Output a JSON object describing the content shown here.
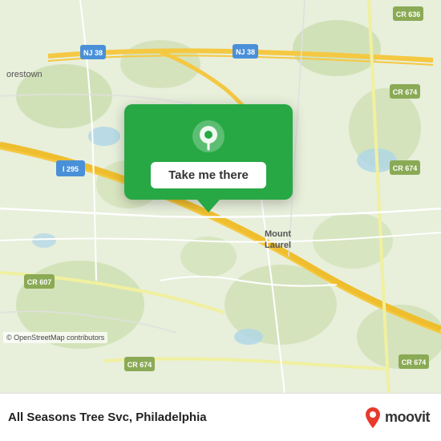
{
  "map": {
    "attribution": "© OpenStreetMap contributors"
  },
  "callout": {
    "button_label": "Take me there"
  },
  "info_bar": {
    "place_name": "All Seasons Tree Svc, Philadelphia",
    "moovit_label": "moovit"
  }
}
